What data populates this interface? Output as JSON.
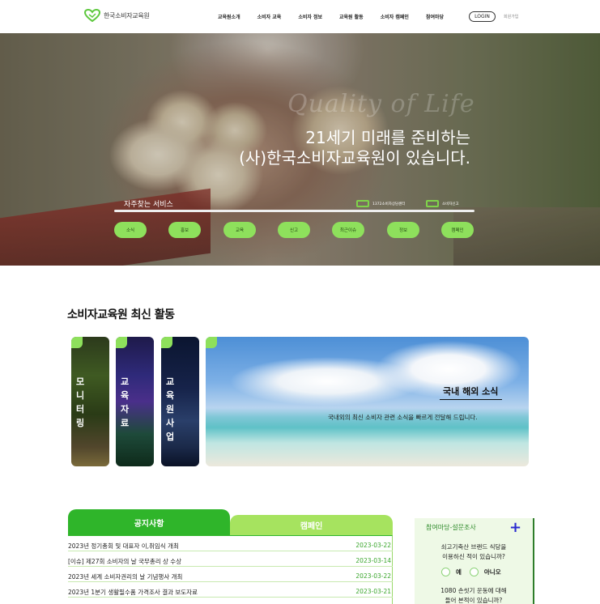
{
  "header": {
    "logo_text": "한국소비자교육원",
    "nav": [
      "교육원소개",
      "소비자 교육",
      "소비자 정보",
      "교육원 활동",
      "소비자 캠페인",
      "참여마당"
    ],
    "login_label": "LOGIN",
    "join_label": "회원가입"
  },
  "hero": {
    "script_text": "Quality of Life",
    "title_line1": "21세기 미래를 준비하는",
    "title_line2": "(사)한국소비자교육원이 있습니다.",
    "services_label": "자주찾는 서비스",
    "links": [
      "1372소비자상담센터",
      "소비자신고"
    ],
    "quick_buttons": [
      "소식",
      "홍보",
      "교육",
      "신고",
      "최근이슈",
      "정보",
      "캠페인"
    ]
  },
  "activity": {
    "section_title": "소비자교육원 최신 활동",
    "cards": [
      {
        "label": "모니터링"
      },
      {
        "label": "교육자료"
      },
      {
        "label": "교육원사업"
      }
    ],
    "featured": {
      "title": "국내 해외 소식",
      "description": "국내외의 최신 소비자 관련 소식을 빠르게 전달해 드립니다."
    }
  },
  "notices": {
    "tab_active": "공지사항",
    "tab_inactive": "캠페인",
    "items": [
      {
        "title": "2023년 정기총회 및 대표자 이,취임식 개최",
        "date": "2023-03-22"
      },
      {
        "title": "[이슈] 제27회 소비자의 날 국무총리 상 수상",
        "date": "2023-03-14"
      },
      {
        "title": "2023년 세계 소비자권리의 날 기념행사 개최",
        "date": "2023-03-22"
      },
      {
        "title": "2023년 1분기 생활필수품 가격조사 결과 보도자료",
        "date": "2023-03-21"
      }
    ]
  },
  "survey": {
    "title": "참여마당-설문조사",
    "question1": [
      "쇠고기축산 브랜드 식당을",
      "이용하신 적이 있습니까?"
    ],
    "options": [
      "예",
      "아니오"
    ],
    "question2": [
      "1080 손씻기 운동에 대해",
      "들어 본적이 있습니까?"
    ]
  },
  "colors": {
    "brand_green": "#2fb52a",
    "light_green": "#8ee05c",
    "date_green": "#3aa62c"
  }
}
